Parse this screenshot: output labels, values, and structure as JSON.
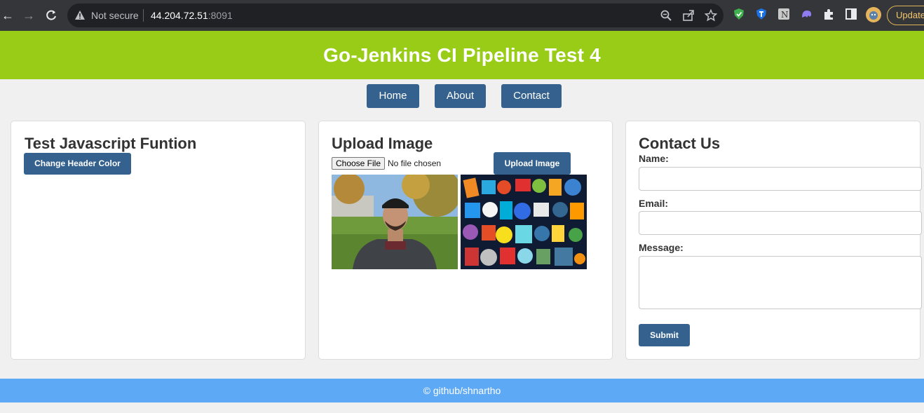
{
  "browser": {
    "security_label": "Not secure",
    "url_host": "44.204.72.51",
    "url_port": ":8091",
    "update_label": "Update"
  },
  "header": {
    "title": "Go-Jenkins CI Pipeline Test 4"
  },
  "nav": {
    "home": "Home",
    "about": "About",
    "contact": "Contact"
  },
  "js_card": {
    "title": "Test Javascript Funtion",
    "button_label": "Change Header Color"
  },
  "upload_card": {
    "title": "Upload Image",
    "choose_file_label": "Choose File",
    "file_status": "No file chosen",
    "upload_button_label": "Upload Image",
    "images": [
      "portrait-photo",
      "tech-logos-collage"
    ]
  },
  "contact_card": {
    "title": "Contact Us",
    "name_label": "Name:",
    "name_value": "",
    "email_label": "Email:",
    "email_value": "",
    "message_label": "Message:",
    "message_value": "",
    "submit_label": "Submit"
  },
  "footer": {
    "text": "© github/shnartho"
  },
  "colors": {
    "header_bg": "#99cc17",
    "button_bg": "#34618e",
    "footer_bg": "#5ea9f5",
    "page_bg": "#f0f0f0"
  }
}
